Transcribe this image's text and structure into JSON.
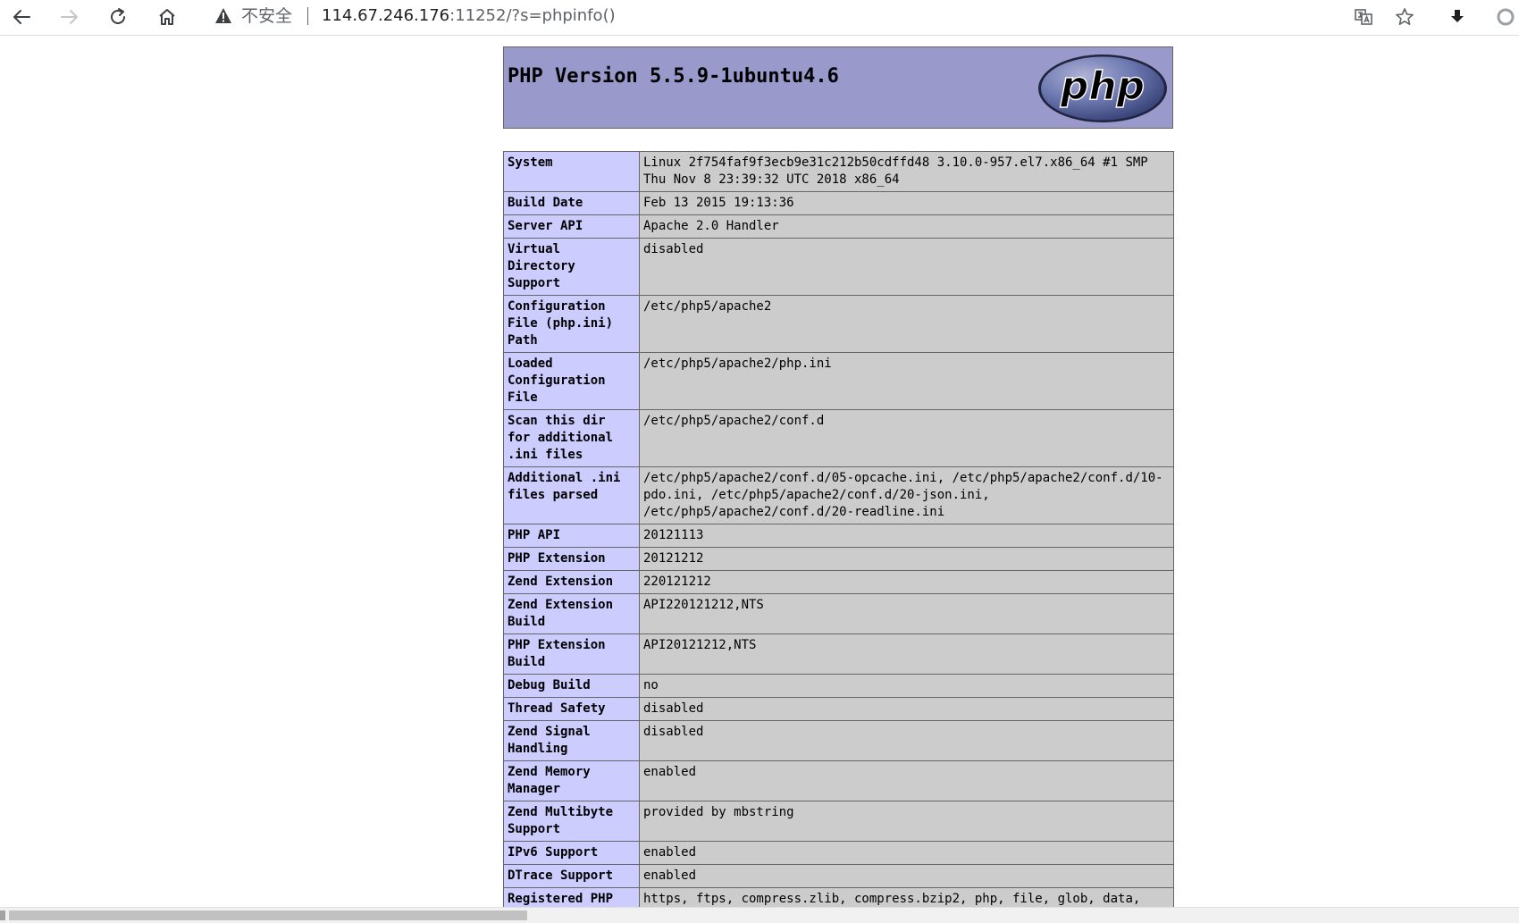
{
  "browser": {
    "security_label": "不安全",
    "url_host": "114.67.246.176",
    "url_rest": ":11252/?s=phpinfo()",
    "icons": [
      "back-icon",
      "forward-icon",
      "reload-icon",
      "home-icon",
      "warning-icon",
      "translate-icon",
      "bookmark-star-icon",
      "download-icon",
      "profile-icon"
    ]
  },
  "phpinfo": {
    "title": "PHP Version 5.5.9-1ubuntu4.6",
    "logo_text": "php",
    "rows": [
      {
        "key": "System",
        "value": "Linux 2f754faf9f3ecb9e31c212b50cdffd48 3.10.0-957.el7.x86_64 #1 SMP Thu Nov 8 23:39:32 UTC 2018 x86_64"
      },
      {
        "key": "Build Date",
        "value": "Feb 13 2015 19:13:36"
      },
      {
        "key": "Server API",
        "value": "Apache 2.0 Handler"
      },
      {
        "key": "Virtual Directory Support",
        "value": "disabled"
      },
      {
        "key": "Configuration File (php.ini) Path",
        "value": "/etc/php5/apache2"
      },
      {
        "key": "Loaded Configuration File",
        "value": "/etc/php5/apache2/php.ini"
      },
      {
        "key": "Scan this dir for additional .ini files",
        "value": "/etc/php5/apache2/conf.d"
      },
      {
        "key": "Additional .ini files parsed",
        "value": "/etc/php5/apache2/conf.d/05-opcache.ini, /etc/php5/apache2/conf.d/10-pdo.ini, /etc/php5/apache2/conf.d/20-json.ini, /etc/php5/apache2/conf.d/20-readline.ini"
      },
      {
        "key": "PHP API",
        "value": "20121113"
      },
      {
        "key": "PHP Extension",
        "value": "20121212"
      },
      {
        "key": "Zend Extension",
        "value": "220121212"
      },
      {
        "key": "Zend Extension Build",
        "value": "API220121212,NTS"
      },
      {
        "key": "PHP Extension Build",
        "value": "API20121212,NTS"
      },
      {
        "key": "Debug Build",
        "value": "no"
      },
      {
        "key": "Thread Safety",
        "value": "disabled"
      },
      {
        "key": "Zend Signal Handling",
        "value": "disabled"
      },
      {
        "key": "Zend Memory Manager",
        "value": "enabled"
      },
      {
        "key": "Zend Multibyte Support",
        "value": "provided by mbstring"
      },
      {
        "key": "IPv6 Support",
        "value": "enabled"
      },
      {
        "key": "DTrace Support",
        "value": "enabled"
      },
      {
        "key": "Registered PHP Streams",
        "value": "https, ftps, compress.zlib, compress.bzip2, php, file, glob, data, http, ftp, phar, zip"
      }
    ]
  },
  "colors": {
    "header_bg": "#9999cc",
    "key_bg": "#ccccff",
    "value_bg": "#cccccc",
    "border": "#666666"
  }
}
